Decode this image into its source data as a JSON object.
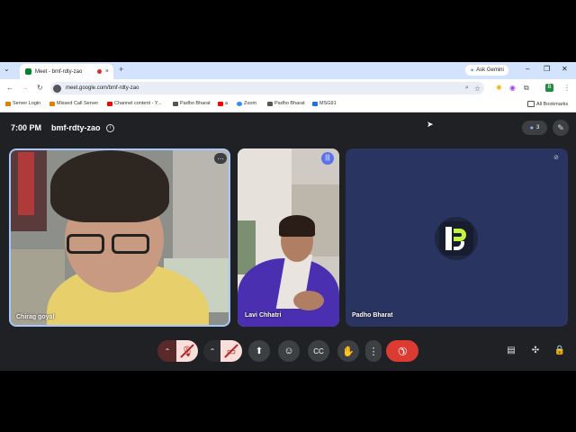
{
  "browser": {
    "tab_title": "Meet - bmf-rdty-zao",
    "tab_close": "×",
    "new_tab": "+",
    "ask_gemini": "Ask Gemini",
    "url": "meet.google.com/bmf-rdty-zao",
    "bookmarks": [
      {
        "label": "Server Login",
        "color": "#e67c00"
      },
      {
        "label": "Missed Call Server",
        "color": "#e67c00"
      },
      {
        "label": "Channel content - Y...",
        "color": "#ff0000"
      },
      {
        "label": "Padho Bharat",
        "color": "#555555"
      },
      {
        "label": "a",
        "color": "#ff0000"
      },
      {
        "label": "Zoom",
        "color": "#2d8cff"
      },
      {
        "label": "Padho Bharat",
        "color": "#555555"
      },
      {
        "label": "MSG91",
        "color": "#1a73e8"
      }
    ],
    "all_bookmarks": "All Bookmarks"
  },
  "meet": {
    "time": "7:00 PM",
    "meeting_code": "bmf-rdty-zao",
    "participant_count": "3",
    "participants": [
      {
        "name": "Chirag goyal"
      },
      {
        "name": "Lavi Chhatri"
      },
      {
        "name": "Padho Bharat"
      }
    ]
  },
  "colors": {
    "meet_bg": "#202124",
    "end_call": "#dc3b32",
    "muted_bg": "#f9dedc",
    "logo_accent": "#c2f53b"
  }
}
